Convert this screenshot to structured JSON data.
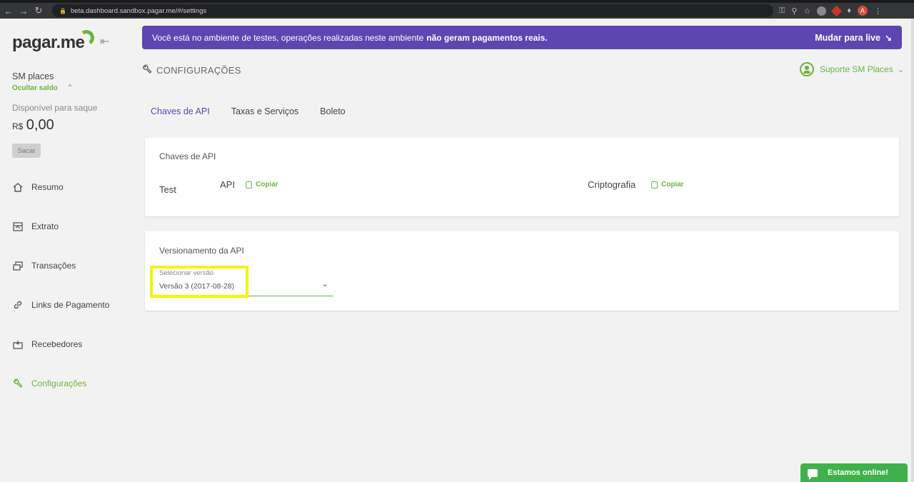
{
  "browser": {
    "url": "beta.dashboard.sandbox.pagar.me/#/settings",
    "profile_initial": "A"
  },
  "sidebar": {
    "logo": "pagar.me",
    "account_name": "SM places",
    "hide_balance": "Ocultar saldo",
    "available_label": "Disponível para saque",
    "currency": "R$",
    "balance": "0,00",
    "withdraw_button": "Sacar",
    "items": [
      {
        "label": "Resumo",
        "icon": "home-icon"
      },
      {
        "label": "Extrato",
        "icon": "statement-icon"
      },
      {
        "label": "Transações",
        "icon": "transactions-icon"
      },
      {
        "label": "Links de Pagamento",
        "icon": "link-icon"
      },
      {
        "label": "Recebedores",
        "icon": "recipients-icon"
      },
      {
        "label": "Configurações",
        "icon": "wrench-icon",
        "active": true
      }
    ]
  },
  "banner": {
    "text": "Você está no ambiente de testes, operações realizadas neste ambiente",
    "strong": "não geram pagamentos reais.",
    "action": "Mudar para live"
  },
  "header": {
    "title": "CONFIGURAÇÕES",
    "support": "Suporte SM Places"
  },
  "tabs": [
    {
      "label": "Chaves de API",
      "active": true
    },
    {
      "label": "Taxas e Serviços"
    },
    {
      "label": "Boleto"
    }
  ],
  "api_keys": {
    "title": "Chaves de API",
    "environment": "Test",
    "api_label": "API",
    "crypto_label": "Criptografia",
    "copy_label": "Copiar"
  },
  "versioning": {
    "title": "Versionamento da API",
    "select_label": "Selecionar versão",
    "select_value": "Versão 3 (2017-08-28)"
  },
  "chat": {
    "label": "Estamos online!"
  },
  "colors": {
    "brand_green": "#6db33f",
    "banner_purple": "#5f45b0",
    "highlight_yellow": "#f5f500"
  }
}
